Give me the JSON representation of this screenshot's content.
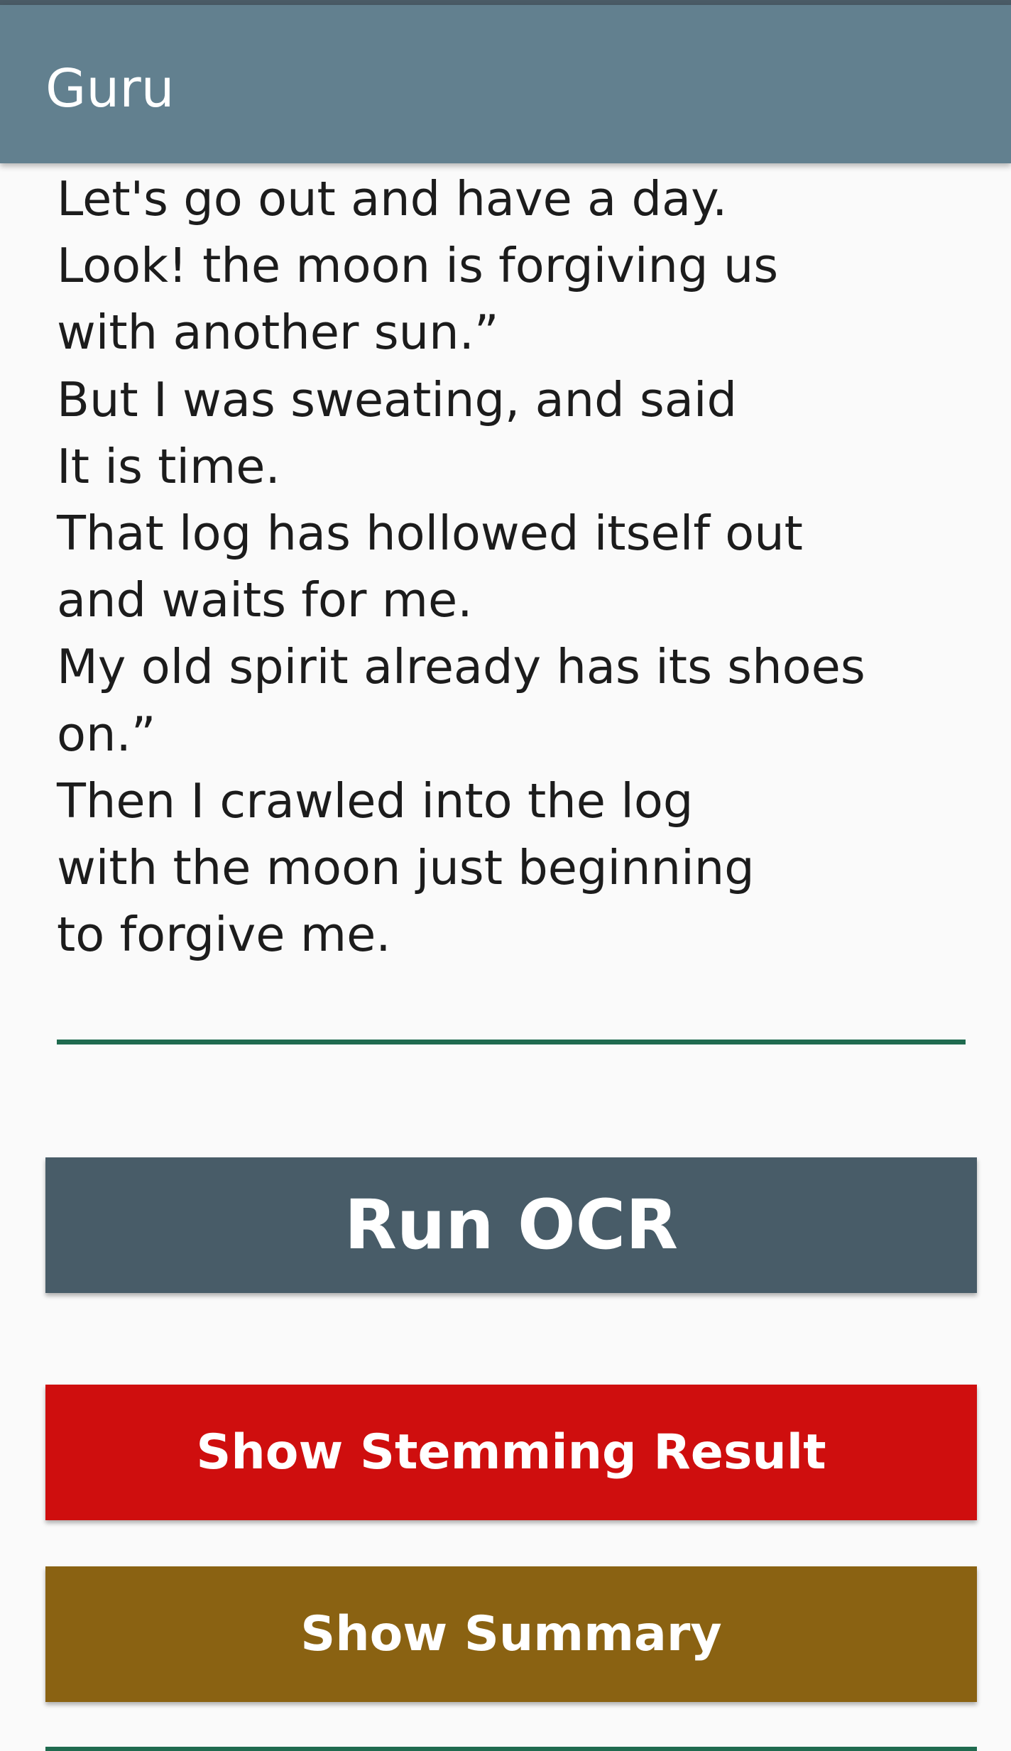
{
  "app_bar": {
    "title": "Guru"
  },
  "ocr_text": {
    "content": "Let's go out and have a day.\nLook! the moon is forgiving us\nwith another sun.”\nBut I was sweating, and said\nIt is time.\nThat log has hollowed itself out\nand waits for me.\nMy old spirit already has its shoes\non.”\nThen I crawled into the log\nwith the moon just beginning\nto forgive me."
  },
  "buttons": {
    "run_ocr": "Run OCR",
    "show_stemming": "Show Stemming Result",
    "show_summary": "Show Summary"
  },
  "colors": {
    "app_bar": "#62808f",
    "run_ocr": "#485c68",
    "show_stemming": "#cf0e0e",
    "show_summary": "#8a6212",
    "underline": "#1f6b4f"
  }
}
